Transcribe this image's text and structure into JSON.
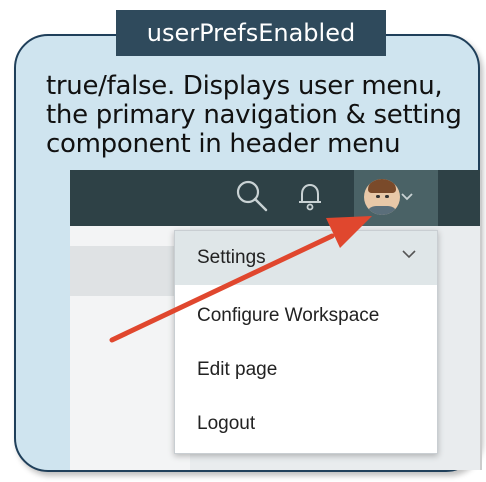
{
  "callout": {
    "title": "userPrefsEnabled",
    "description": "true/false. Displays user menu, the primary navigation & setting component in header menu"
  },
  "header": {
    "icons": [
      "search-icon",
      "bell-icon",
      "avatar",
      "chevron-down-icon"
    ]
  },
  "user_menu": {
    "items": [
      {
        "label": "Settings",
        "icon": "chevron-down-icon"
      },
      {
        "label": "Configure Workspace"
      },
      {
        "label": "Edit page"
      },
      {
        "label": "Logout"
      }
    ]
  },
  "colors": {
    "header_bg": "#2e4146",
    "card_bg": "#cfe4ef",
    "arrow": "#e0472e",
    "title_tag_bg": "#2f4a5c"
  }
}
